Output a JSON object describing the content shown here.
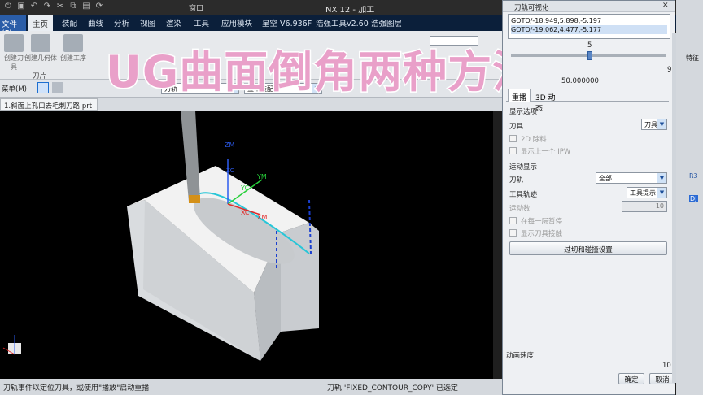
{
  "titlebar": {
    "title": "NX 12 - 加工",
    "window_menu": "窗口"
  },
  "tabs": {
    "file": "文件(F)",
    "items": [
      "主页",
      "装配",
      "曲线",
      "分析",
      "视图",
      "渲染",
      "工具",
      "应用模块",
      "星空 V6.936F",
      "浩强工具v2.60",
      "浩强图层"
    ]
  },
  "ribbon": {
    "buttons": [
      "创建刀具",
      "创建几何体",
      "创建工序"
    ],
    "group_label": "刀片",
    "toolbar_menu": "菜单(M)",
    "filter1": "刀轨",
    "filter2": "整个装配"
  },
  "file_tab": {
    "name": "1.斜面上孔口去毛刺刀路.prt"
  },
  "overlay_title": "UG曲面倒角两种方法",
  "viewport": {
    "axis_zm": "ZM",
    "axis_ym": "YM",
    "axis_xm": "XM",
    "axis_yc": "YC",
    "axis_xc": "XC",
    "axis_zc": "ZC"
  },
  "status": {
    "left": "刀轨事件以定位刀具，或使用\"播放\"启动重播",
    "right": "刀轨 'FIXED_CONTOUR_COPY' 已选定"
  },
  "dialog": {
    "title": "刀轨可视化",
    "goto_lines": [
      "GOTO/-18.949,5.898,-5.197",
      "GOTO/-19.062,4.477,-5.177"
    ],
    "slider_value": "5",
    "slider_max": "9",
    "partial_value": "50.000000",
    "tabs": [
      "重播",
      "3D 动态"
    ],
    "display_options_label": "显示选项",
    "tool_label": "刀具",
    "tool_value": "刀具",
    "chk_2d_remove": "2D 除料",
    "chk_show_prev_ipw": "显示上一个 IPW",
    "motion_display_label": "运动显示",
    "path_label": "刀轨",
    "path_value": "全部",
    "tool_trace_label": "工具轨迹",
    "tool_trace_value": "工具提示",
    "motion_count_label": "运动数",
    "motion_count_value": "10",
    "chk_pause_each_level": "在每一层暂停",
    "chk_show_tool_contact": "显示刀具接触",
    "overcut_button": "过切和碰撞设置",
    "anim_speed_label": "动画速度",
    "anim_speed_value": "10",
    "ok_button": "确定",
    "cancel_button": "取消"
  },
  "right_strip": {
    "label1": "特征",
    "label2": "R3",
    "label3": "DJ"
  }
}
